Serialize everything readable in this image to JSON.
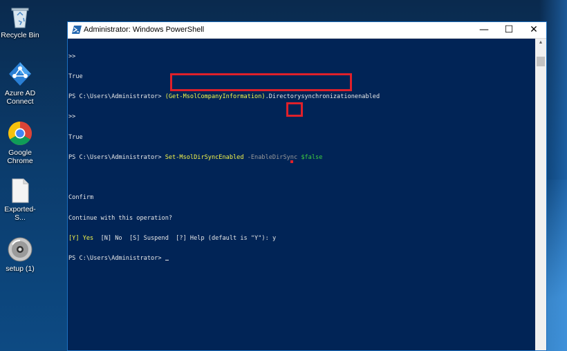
{
  "desktop": {
    "icons": [
      {
        "label": "Recycle Bin",
        "icon": "recycle-bin-icon"
      },
      {
        "label": "Azure AD Connect",
        "icon": "azure-ad-connect-icon"
      },
      {
        "label": "Google Chrome",
        "icon": "chrome-icon"
      },
      {
        "label": "Exported-S...",
        "icon": "file-icon"
      },
      {
        "label": "setup (1)",
        "icon": "disc-setup-icon"
      }
    ]
  },
  "window": {
    "title": "Administrator: Windows PowerShell",
    "controls": {
      "minimize": "—",
      "maximize": "☐",
      "close": "✕"
    }
  },
  "console": {
    "lines": [
      ">>",
      "True",
      "PS C:\\Users\\Administrator> ",
      ">>",
      "True",
      "PS C:\\Users\\Administrator> ",
      "",
      "Confirm",
      "Continue with this operation?",
      " Help (default is \"Y\"): ",
      "PS C:\\Users\\Administrator> "
    ],
    "cmd1": "(Get-MsolCompanyInformation)",
    "cmd1_rest": ".Directorysynchronizationenabled",
    "cmd2": "Set-MsolDirSyncEnabled",
    "cmd2_param": " -EnableDirSync ",
    "cmd2_value": "$false",
    "prompt_yes": "[Y] Yes",
    "prompt_rest": "  [N] No  [S] Suspend  [?]",
    "answer": "y"
  },
  "colors": {
    "console_bg": "#012456",
    "command": "#f5f54a",
    "parameter": "#9a9a9a",
    "variable": "#3fcf3f",
    "highlight": "#e0202a"
  }
}
